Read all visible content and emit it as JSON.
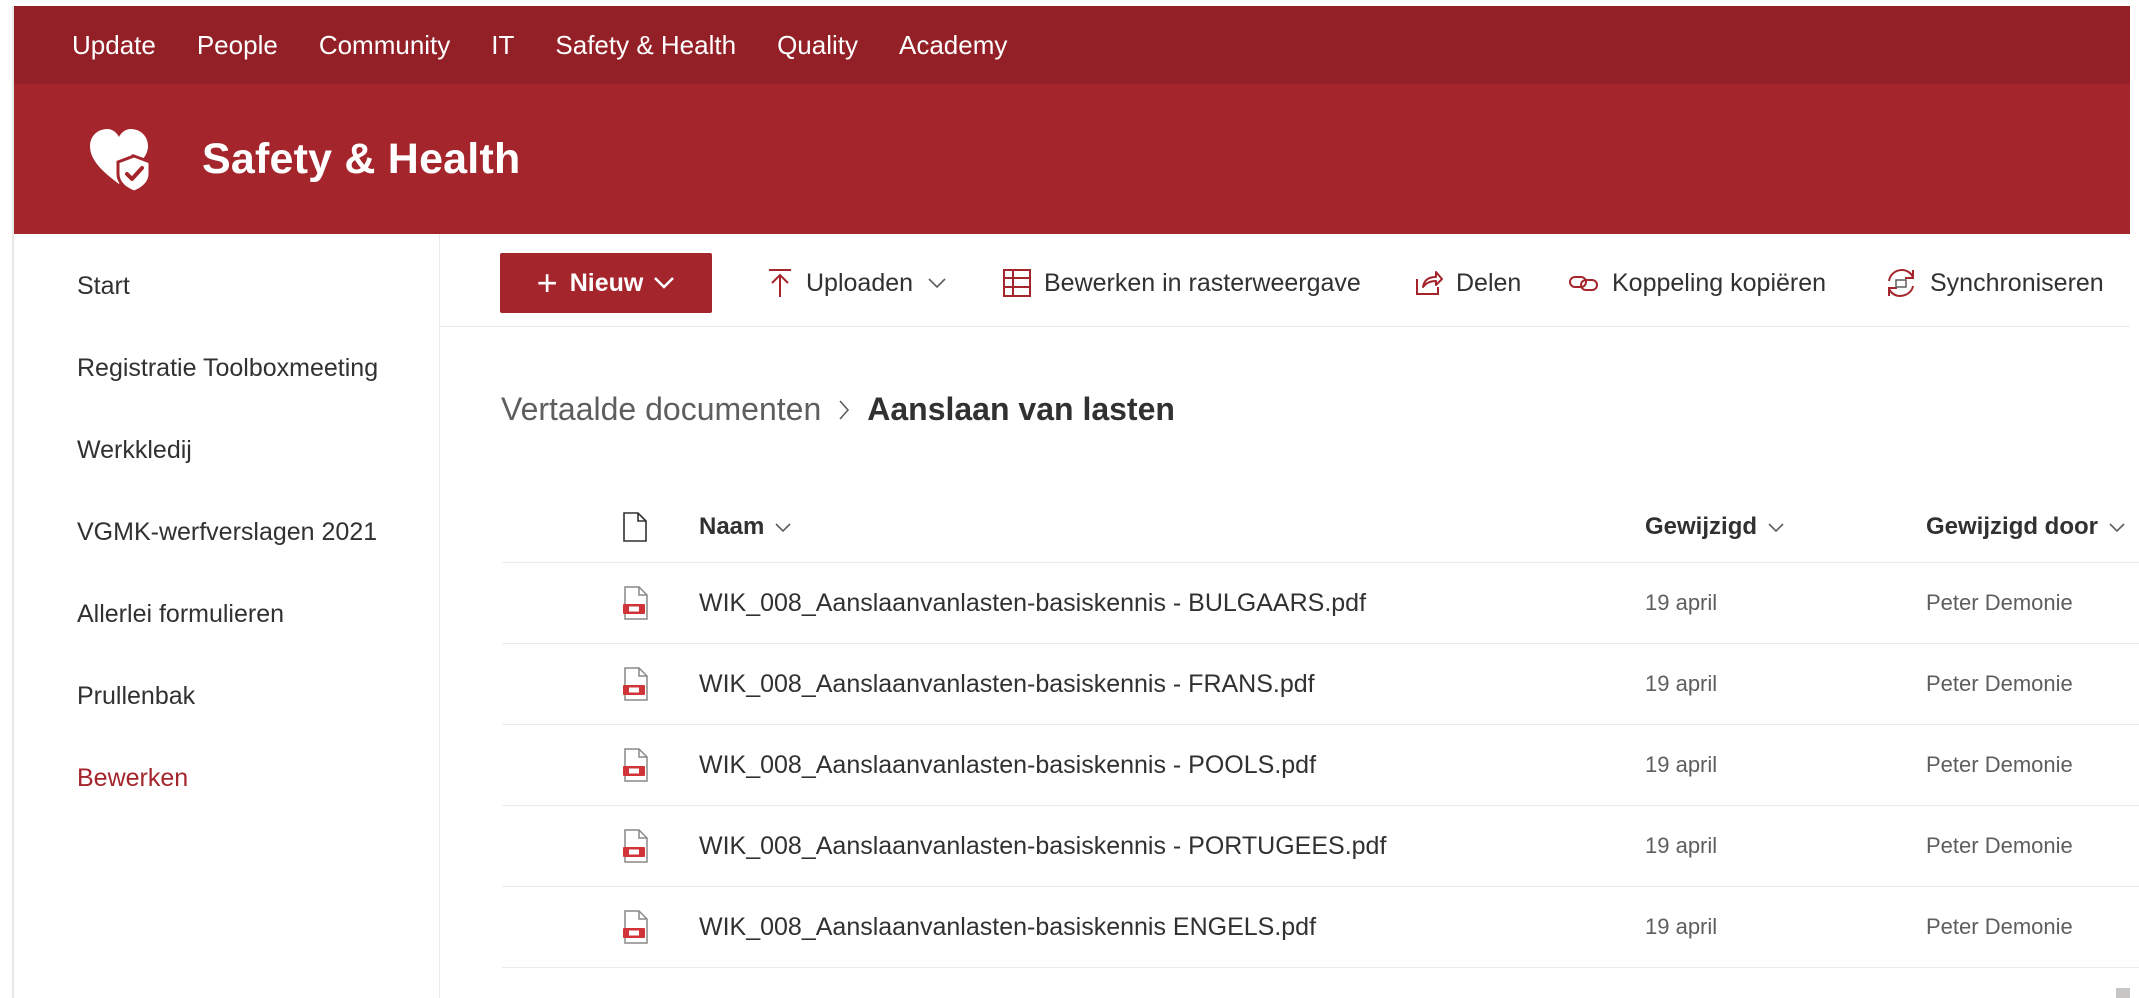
{
  "topnav": {
    "items": [
      "Update",
      "People",
      "Community",
      "IT",
      "Safety & Health",
      "Quality",
      "Academy"
    ]
  },
  "site": {
    "title": "Safety & Health",
    "logo_icon": "heart-shield-icon"
  },
  "leftnav": {
    "items": [
      "Start",
      "Registratie Toolboxmeeting",
      "Werkkledij",
      "VGMK-werfverslagen 2021",
      "Allerlei formulieren",
      "Prullenbak"
    ],
    "edit_label": "Bewerken"
  },
  "commandbar": {
    "new_label": "Nieuw",
    "upload_label": "Uploaden",
    "grid_edit_label": "Bewerken in rasterweergave",
    "share_label": "Delen",
    "copy_link_label": "Koppeling kopiëren",
    "sync_label": "Synchroniseren"
  },
  "breadcrumb": {
    "parent": "Vertaalde documenten",
    "current": "Aanslaan van lasten"
  },
  "list": {
    "columns": {
      "name": "Naam",
      "modified": "Gewijzigd",
      "modified_by": "Gewijzigd door"
    },
    "rows": [
      {
        "name": "WIK_008_Aanslaanvanlasten-basiskennis - BULGAARS.pdf",
        "modified": "19 april",
        "modified_by": "Peter Demonie"
      },
      {
        "name": "WIK_008_Aanslaanvanlasten-basiskennis - FRANS.pdf",
        "modified": "19 april",
        "modified_by": "Peter Demonie"
      },
      {
        "name": "WIK_008_Aanslaanvanlasten-basiskennis - POOLS.pdf",
        "modified": "19 april",
        "modified_by": "Peter Demonie"
      },
      {
        "name": "WIK_008_Aanslaanvanlasten-basiskennis - PORTUGEES.pdf",
        "modified": "19 april",
        "modified_by": "Peter Demonie"
      },
      {
        "name": "WIK_008_Aanslaanvanlasten-basiskennis ENGELS.pdf",
        "modified": "19 april",
        "modified_by": "Peter Demonie"
      }
    ]
  },
  "colors": {
    "topbar": "#932026",
    "sitebar": "#a4262c",
    "accent": "#a4262c"
  }
}
